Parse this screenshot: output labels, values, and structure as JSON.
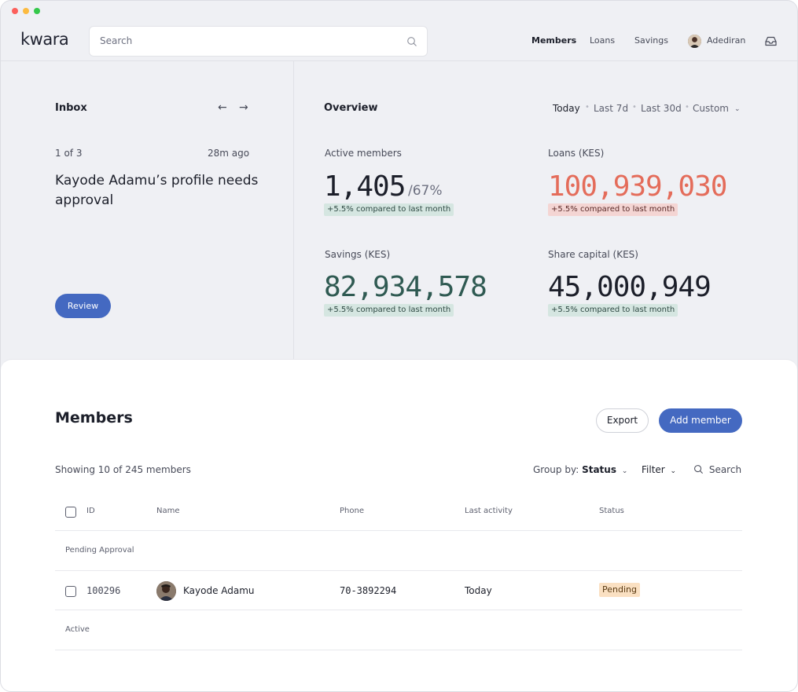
{
  "app": {
    "logo": "kwara"
  },
  "topbar": {
    "search_placeholder": "Search",
    "nav": [
      "Members",
      "Loans",
      "Savings"
    ],
    "user_name": "Adediran"
  },
  "inbox": {
    "title": "Inbox",
    "prev_arrow": "←",
    "next_arrow": "→",
    "count": "1 of 3",
    "time": "28m ago",
    "message": "Kayode Adamu’s profile needs approval",
    "review_label": "Review"
  },
  "overview": {
    "title": "Overview",
    "ranges": [
      "Today",
      "Last 7d",
      "Last 30d",
      "Custom"
    ],
    "active_range": "Today",
    "stats": [
      {
        "label": "Active members",
        "value": "1,405",
        "suffix": "/67%",
        "change": "+5.5% compared to last month",
        "tone": "positive"
      },
      {
        "label": "Loans (KES)",
        "value": "100,939,030",
        "suffix": "",
        "change": "+5.5% compared to last month",
        "tone": "negative"
      },
      {
        "label": "Savings (KES)",
        "value": "82,934,578",
        "suffix": "",
        "change": "+5.5% compared to last month",
        "tone": "positive"
      },
      {
        "label": "Share capital (KES)",
        "value": "45,000,949",
        "suffix": "",
        "change": "+5.5% compared to last month",
        "tone": "positive"
      }
    ]
  },
  "members": {
    "title": "Members",
    "export_label": "Export",
    "add_label": "Add member",
    "showing": "Showing 10 of 245 members",
    "group_by_label": "Group by:",
    "group_by_value": "Status",
    "filter_label": "Filter",
    "search_label": "Search",
    "columns": [
      "ID",
      "Name",
      "Phone",
      "Last activity",
      "Status"
    ],
    "groups": [
      {
        "label": "Pending Approval",
        "rows": [
          {
            "id": "100296",
            "name": "Kayode Adamu",
            "phone": "70-3892294",
            "last_activity": "Today",
            "status": "Pending"
          }
        ]
      },
      {
        "label": "Active",
        "rows": []
      }
    ]
  },
  "colors": {
    "accent": "#4469c1",
    "positive_value": "#2f5a52",
    "negative_value": "#e46c5a",
    "pending_pill": "#fae0c2"
  }
}
